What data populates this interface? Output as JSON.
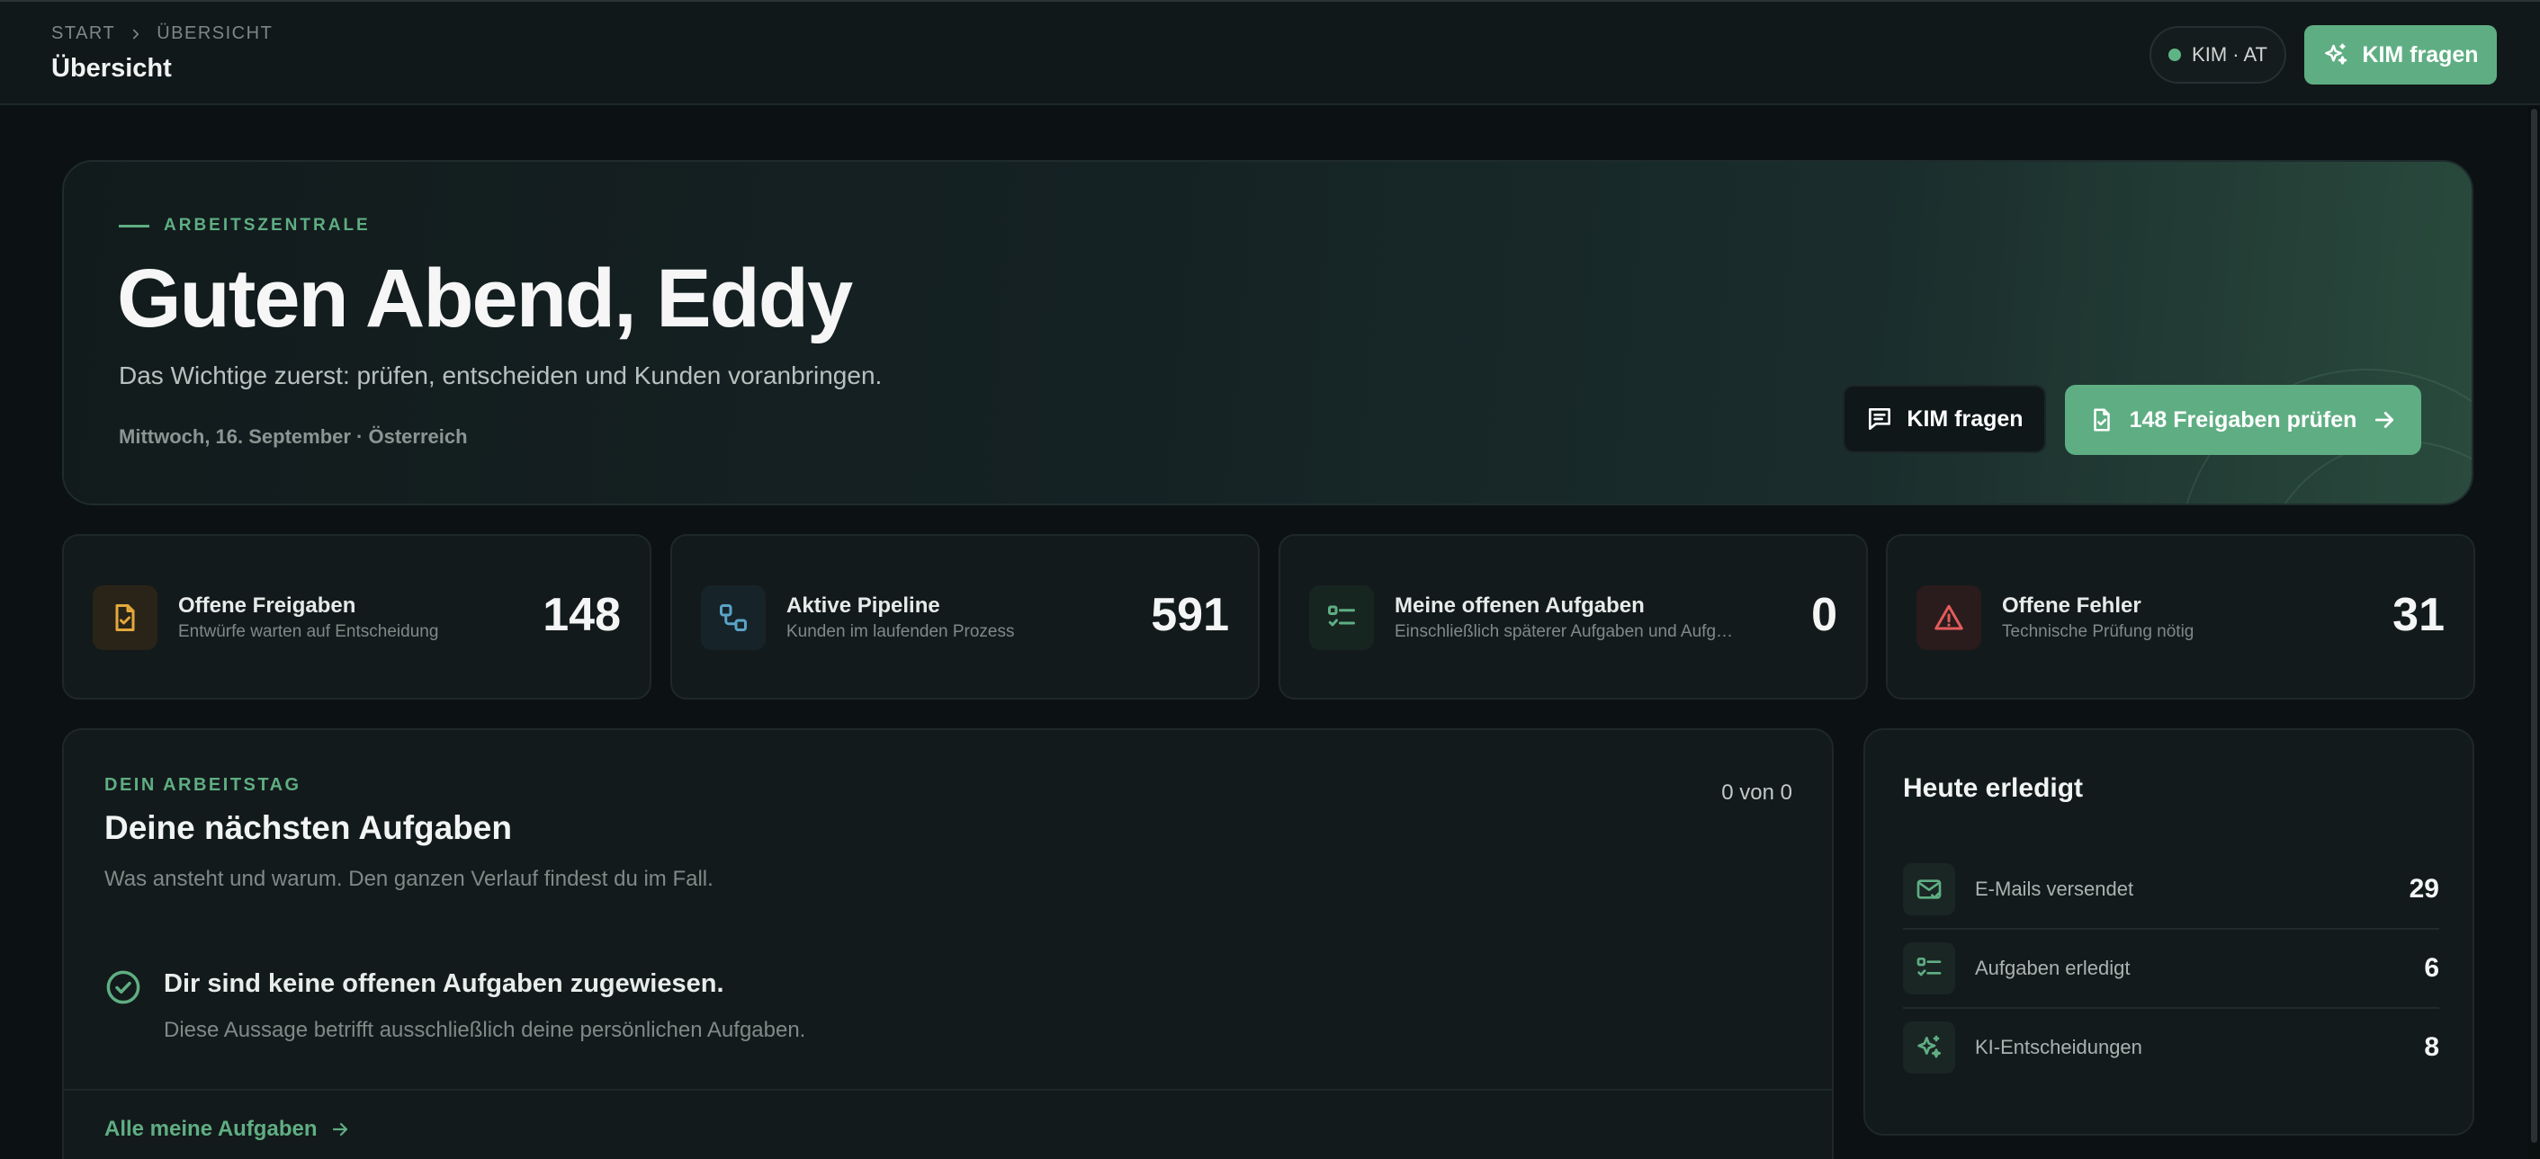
{
  "header": {
    "breadcrumb": [
      "START",
      "ÜBERSICHT"
    ],
    "title": "Übersicht",
    "region": "KIM · AT",
    "ask_button": "KIM fragen"
  },
  "hero": {
    "eyebrow": "ARBEITSZENTRALE",
    "greeting": "Guten Abend, Eddy",
    "subtitle": "Das Wichtige zuerst: prüfen, entscheiden und Kunden voranbringen.",
    "date": "Mittwoch, 16. September · Österreich",
    "ask_button": "KIM fragen",
    "review_button": "148 Freigaben prüfen"
  },
  "stats": [
    {
      "label": "Offene Freigaben",
      "desc": "Entwürfe warten auf Entscheidung",
      "value": "148",
      "icon": "document-check-icon",
      "color": "#e3a93c"
    },
    {
      "label": "Aktive Pipeline",
      "desc": "Kunden im laufenden Prozess",
      "value": "591",
      "icon": "workflow-icon",
      "color": "#5aa3c8"
    },
    {
      "label": "Meine offenen Aufgaben",
      "desc": "Einschließlich späterer Aufgaben und Aufgaben",
      "value": "0",
      "icon": "checklist-icon",
      "color": "#5fae83"
    },
    {
      "label": "Offene Fehler",
      "desc": "Technische Prüfung nötig",
      "value": "31",
      "icon": "warning-icon",
      "color": "#e25c5c"
    }
  ],
  "tasks": {
    "kicker": "DEIN ARBEITSTAG",
    "title": "Deine nächsten Aufgaben",
    "subtitle": "Was ansteht und warum. Den ganzen Verlauf findest du im Fall.",
    "count": "0 von 0",
    "empty_title": "Dir sind keine offenen Aufgaben zugewiesen.",
    "empty_sub": "Diese Aussage betrifft ausschließlich deine persönlichen Aufgaben.",
    "all_link": "Alle meine Aufgaben"
  },
  "done": {
    "title": "Heute erledigt",
    "rows": [
      {
        "label": "E-Mails versendet",
        "value": "29",
        "icon": "mail-check-icon"
      },
      {
        "label": "Aufgaben erledigt",
        "value": "6",
        "icon": "checklist-icon"
      },
      {
        "label": "KI-Entscheidungen",
        "value": "8",
        "icon": "sparkles-icon"
      }
    ]
  },
  "colors": {
    "accent": "#5fae83",
    "background": "#0c1213",
    "card": "#131a1b"
  }
}
